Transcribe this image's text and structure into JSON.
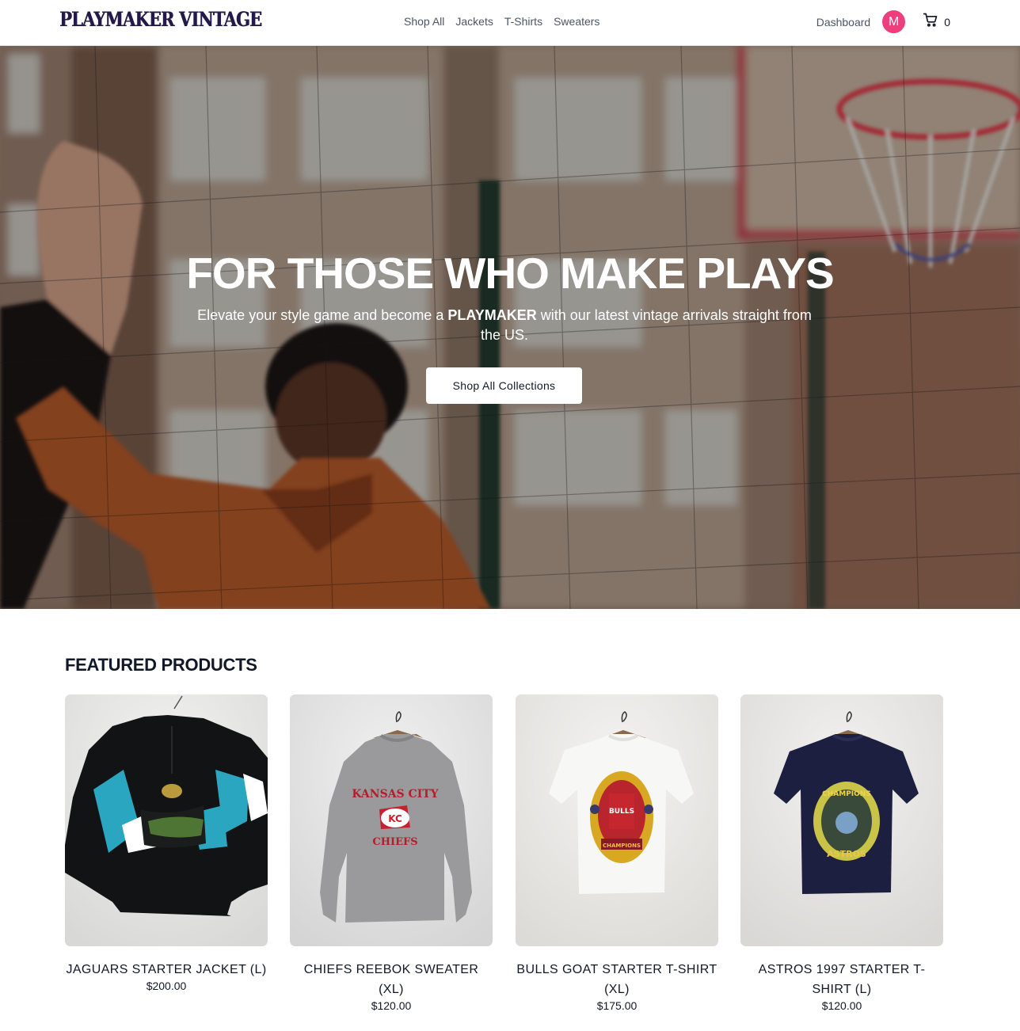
{
  "brand": {
    "logo_text": "PLAYMAKER VINTAGE"
  },
  "nav": {
    "links": [
      "Shop All",
      "Jackets",
      "T-Shirts",
      "Sweaters"
    ],
    "dashboard": "Dashboard",
    "avatar_initial": "M",
    "cart_count": "0"
  },
  "hero": {
    "title": "FOR THOSE WHO MAKE PLAYS",
    "subtitle_pre": "Elevate your style game and become a ",
    "subtitle_bold": "PLAYMAKER",
    "subtitle_post": " with our latest vintage arrivals straight from the US.",
    "button": "Shop All Collections"
  },
  "featured": {
    "title": "FEATURED PRODUCTS",
    "products": [
      {
        "name": "JAGUARS STARTER JACKET (L)",
        "price": "$200.00"
      },
      {
        "name": "CHIEFS REEBOK SWEATER (XL)",
        "price": "$120.00"
      },
      {
        "name": "BULLS GOAT STARTER T-SHIRT (XL)",
        "price": "$175.00"
      },
      {
        "name": "ASTROS 1997 STARTER T-SHIRT (L)",
        "price": "$120.00"
      }
    ]
  },
  "colors": {
    "accent_avatar": "#ec3f7b",
    "logo": "#231a4a"
  }
}
